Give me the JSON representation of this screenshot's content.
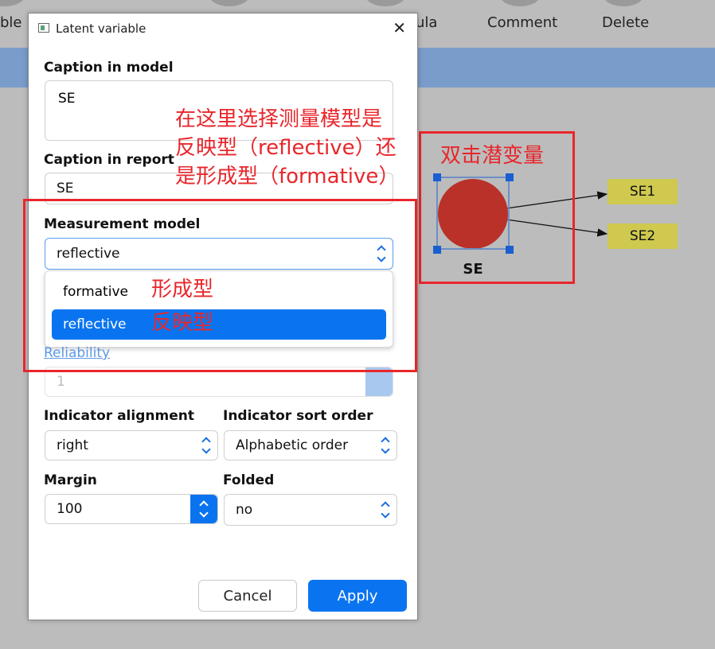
{
  "toolbar": {
    "items": [
      "ble",
      "ula",
      "Comment",
      "Delete"
    ]
  },
  "dialog": {
    "title": "Latent variable",
    "close_glyph": "✕",
    "caption_in_model": {
      "label": "Caption in model",
      "value": "SE"
    },
    "caption_in_report": {
      "label": "Caption in report",
      "value": "SE"
    },
    "measurement_model": {
      "label": "Measurement model",
      "value": "reflective",
      "options": [
        "formative",
        "reflective"
      ],
      "selected_index": 1
    },
    "reliability": {
      "label": "Reliability",
      "value": "1"
    },
    "indicator_alignment": {
      "label": "Indicator alignment",
      "value": "right"
    },
    "indicator_sort_order": {
      "label": "Indicator sort order",
      "value": "Alphabetic order"
    },
    "margin": {
      "label": "Margin",
      "value": "100"
    },
    "folded": {
      "label": "Folded",
      "value": "no"
    },
    "cancel_label": "Cancel",
    "apply_label": "Apply"
  },
  "annotations": {
    "top_note": "在这里选择测量模型是\n反映型（reflective）还\n是形成型（formative）",
    "formative_note": "形成型",
    "reflective_note": "反映型",
    "diagram_note": "双击潜变量"
  },
  "diagram": {
    "latent": {
      "label": "SE",
      "color": "#b93129"
    },
    "indicators": [
      {
        "label": "SE1"
      },
      {
        "label": "SE2"
      }
    ],
    "indicator_color": "#cfc94f"
  },
  "colors": {
    "accent": "#0a74f0",
    "annotation_red": "#e8262b",
    "header_bar": "#7a9ccb"
  }
}
